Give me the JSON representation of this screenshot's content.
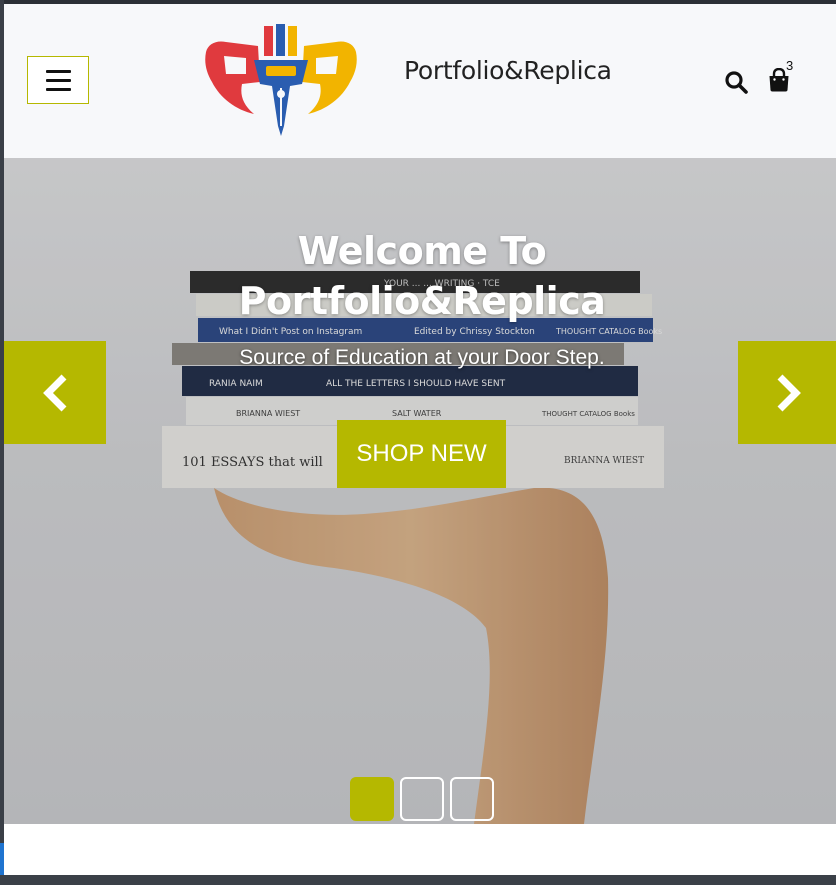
{
  "header": {
    "brand_name": "Portfolio&Replica",
    "cart_count": "3",
    "icons": {
      "menu": "hamburger-menu-icon",
      "search": "search-icon",
      "cart": "shopping-bag-icon",
      "logo": "pen-nib-logo"
    }
  },
  "hero": {
    "title_line1": "Welcome To",
    "title_line2": "Portfolio&Replica",
    "subtitle": "Source of Education at your Door Step.",
    "cta_label": "SHOP NEW",
    "slide_count": 3,
    "active_slide": 1,
    "books": [
      {
        "title": "What I Didn't Post on Instagram",
        "credit": "Edited by Chrissy Stockton",
        "publisher": "THOUGHT CATALOG Books"
      },
      {
        "author": "RANIA NAIM",
        "title": "ALL THE LETTERS I SHOULD HAVE SENT"
      },
      {
        "author": "BRIANNA WIEST",
        "title": "SALT WATER",
        "publisher": "THOUGHT CATALOG Books"
      },
      {
        "title": "101 ESSAYS that will",
        "author": "BRIANNA WIEST"
      }
    ]
  },
  "colors": {
    "accent": "#b5b800",
    "header_bg": "#f7f8fa",
    "text_dark": "#222222",
    "logo_red": "#e03a3e",
    "logo_blue": "#2a5db0",
    "logo_yellow": "#f2b400"
  }
}
